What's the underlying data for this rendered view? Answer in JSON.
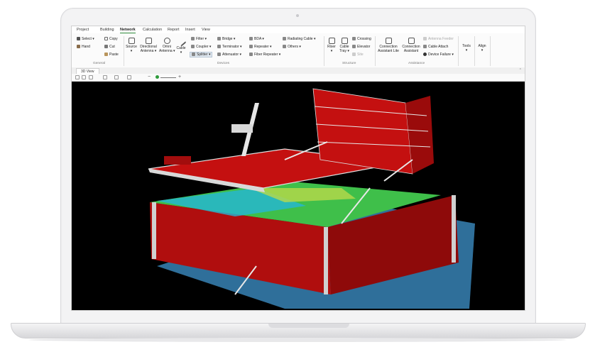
{
  "ribbon_tabs": [
    "Project",
    "Building",
    "Network",
    "Calculation",
    "Report",
    "Insert",
    "View"
  ],
  "active_tab": "Network",
  "general": {
    "select": "Select",
    "hand": "Hand",
    "copy": "Copy",
    "cut": "Cut",
    "paste": "Paste",
    "label": "General"
  },
  "devices": {
    "source": "Source",
    "directional": "Directional",
    "directional2": "Antenna",
    "omni": "Omni",
    "omni2": "Antenna",
    "cable": "Cable",
    "filter": "Filter",
    "coupler": "Coupler",
    "splitter": "Splitter",
    "bridge": "Bridge",
    "terminator": "Terminator",
    "attenuator": "Attenuator",
    "bda": "BDA",
    "repeater": "Repeater",
    "fiber_repeater": "Fiber Repeater",
    "radiating_cable": "Radiating Cable",
    "others": "Others",
    "label": "Devices"
  },
  "structure": {
    "riser": "Riser",
    "cable_tray": "Cable",
    "cable_tray2": "Tray",
    "crossing": "Crossing",
    "elevator": "Elevator",
    "site": "Site",
    "label": "Structure"
  },
  "assistance": {
    "conn_lite": "Connection",
    "conn_lite2": "Assistant Lite",
    "conn": "Connection",
    "conn2": "Assistant",
    "antenna_feeder": "Antenna Feeder",
    "cable_attach": "Cable Attach",
    "device_failure": "Device Failure",
    "label": "Assistance"
  },
  "tools": "Tools",
  "align": "Align",
  "view_tab": "3D View",
  "zoom_minus": "−",
  "zoom_plus": "+",
  "colors": {
    "accent": "#2e8b3a",
    "structure_red": "#c41010",
    "water": "#2f6f9a",
    "floor_green": "#3fbf4a",
    "floor_cyan": "#26b6d6"
  }
}
